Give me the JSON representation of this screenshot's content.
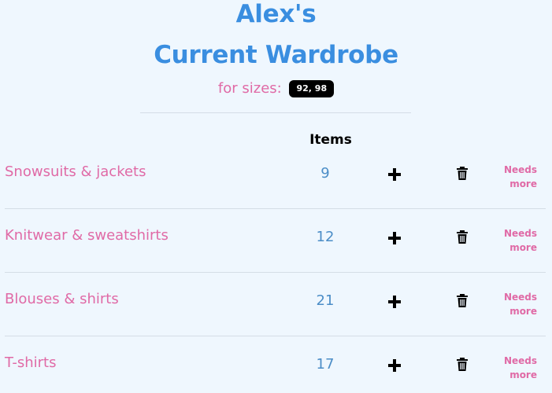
{
  "header": {
    "title_line1": "Alex's",
    "title_line2": "Current Wardrobe",
    "sizes_label": "for sizes:",
    "sizes_value": "92, 98"
  },
  "table": {
    "items_header": "Items",
    "rows": [
      {
        "name": "Snowsuits & jackets",
        "count": "9",
        "needs_line1": "Needs",
        "needs_line2": "more"
      },
      {
        "name": "Knitwear & sweatshirts",
        "count": "12",
        "needs_line1": "Needs",
        "needs_line2": "more"
      },
      {
        "name": "Blouses & shirts",
        "count": "21",
        "needs_line1": "Needs",
        "needs_line2": "more"
      },
      {
        "name": "T-shirts",
        "count": "17",
        "needs_line1": "Needs",
        "needs_line2": "more"
      }
    ]
  },
  "icons": {
    "add": "plus-icon",
    "delete": "trash-icon"
  },
  "colors": {
    "background": "#eff7fe",
    "title": "#3a8ee0",
    "pink": "#e06aa6",
    "count": "#4b8dc7",
    "badge_bg": "#000000"
  }
}
